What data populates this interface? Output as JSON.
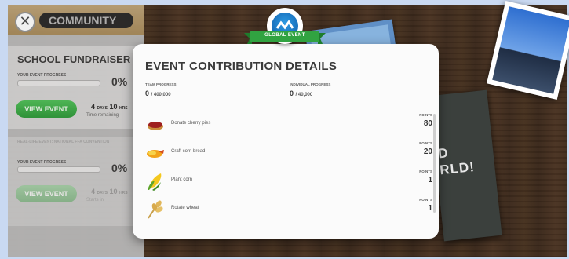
{
  "community": {
    "title": "COMMUNITY"
  },
  "events": [
    {
      "title": "SCHOOL FUNDRAISER",
      "progress_label": "YOUR EVENT PROGRESS",
      "progress_percent": 0,
      "progress_text": "0%",
      "button": "VIEW EVENT",
      "time_value": "4",
      "time_unit_a": "DAYS",
      "time_value_b": "10",
      "time_unit_b": "HRS",
      "time_label": "Time remaining"
    },
    {
      "title": "REAL-LIFE EVENT: NATIONAL FFA CONVENTION",
      "progress_label": "YOUR EVENT PROGRESS",
      "progress_percent": 0,
      "progress_text": "0%",
      "button": "VIEW EVENT",
      "time_value": "4",
      "time_unit_a": "DAYS",
      "time_value_b": "10",
      "time_unit_b": "HRS",
      "time_label": "Starts in"
    }
  ],
  "modal": {
    "banner": "GLOBAL EVENT",
    "title": "EVENT CONTRIBUTION DETAILS",
    "team_label": "TEAM PROGRESS",
    "team_value": "0",
    "team_total": "/ 400,000",
    "individual_label": "INDIVIDUAL PROGRESS",
    "individual_value": "0",
    "individual_total": "/ 40,000",
    "tasks": [
      {
        "icon": "cherry-pie-icon",
        "label": "Donate cherry pies",
        "points_label": "POINTS",
        "points": "80"
      },
      {
        "icon": "corn-bread-icon",
        "label": "Craft corn bread",
        "points_label": "POINTS",
        "points": "20"
      },
      {
        "icon": "corn-icon",
        "label": "Plant corn",
        "points_label": "POINTS",
        "points": "1"
      },
      {
        "icon": "wheat-icon",
        "label": "Rotate wheat",
        "points_label": "POINTS",
        "points": "1"
      }
    ]
  },
  "poster": {
    "line1": "D",
    "line2": "RLD!"
  },
  "colors": {
    "accent_green": "#2e9a3b",
    "badge_blue": "#1a6fc0",
    "wood": "#3f2b1e"
  }
}
